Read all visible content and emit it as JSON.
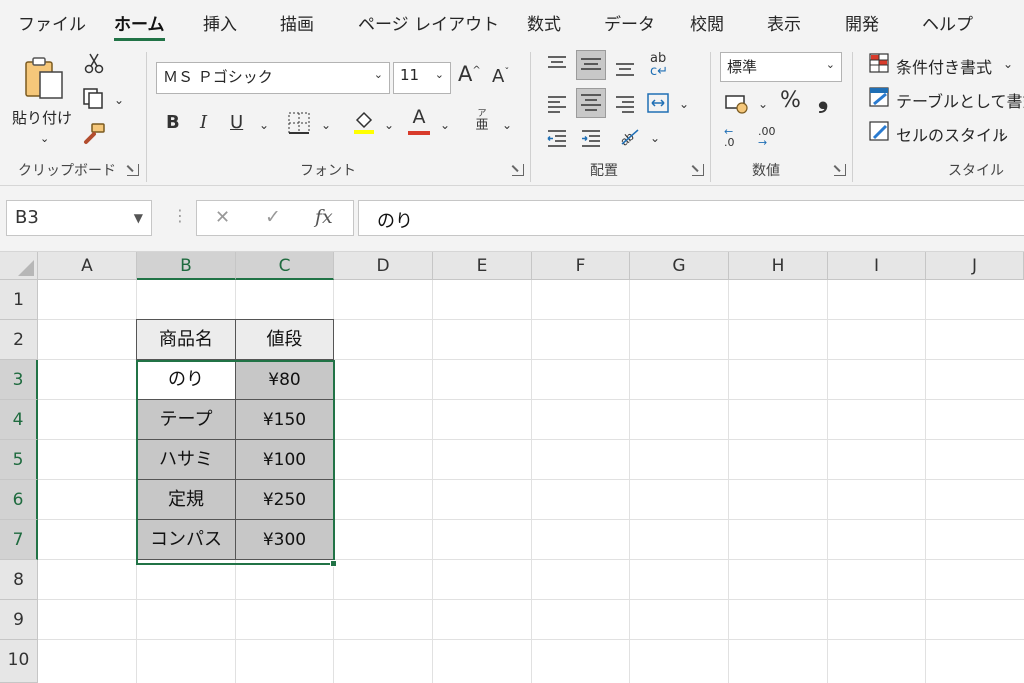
{
  "menu": {
    "tabs": [
      {
        "label": "ファイル"
      },
      {
        "label": "ホーム",
        "active": true
      },
      {
        "label": "挿入"
      },
      {
        "label": "描画"
      },
      {
        "label": "ページ レイアウト"
      },
      {
        "label": "数式"
      },
      {
        "label": "データ"
      },
      {
        "label": "校閲"
      },
      {
        "label": "表示"
      },
      {
        "label": "開発"
      },
      {
        "label": "ヘルプ"
      }
    ]
  },
  "ribbon": {
    "clipboard": {
      "paste_label": "貼り付け",
      "group_label": "クリップボード"
    },
    "font": {
      "font_name": "ＭＳ Ｐゴシック",
      "font_size": "11",
      "group_label": "フォント",
      "bold": "B",
      "italic": "I",
      "underline": "U",
      "phonetic_top": "ア",
      "phonetic_bottom": "亜",
      "grow_label": "A",
      "shrink_label": "A",
      "font_color_label": "A",
      "font_color": "#d83b2b"
    },
    "alignment": {
      "group_label": "配置",
      "wrap_label": "ab"
    },
    "number": {
      "format": "標準",
      "percent": "%",
      "comma": "❟",
      "inc_decimal": ".0",
      "dec_decimal": ".00",
      "group_label": "数値"
    },
    "styles": {
      "conditional": "条件付き書式",
      "as_table": "テーブルとして書式",
      "cell_styles": "セルのスタイル",
      "group_label": "スタイル"
    }
  },
  "formula_bar": {
    "name_box": "B3",
    "cancel": "✕",
    "enter": "✓",
    "fx": "fx",
    "content": "のり"
  },
  "sheet": {
    "columns": [
      "A",
      "B",
      "C",
      "D",
      "E",
      "F",
      "G",
      "H",
      "I",
      "J"
    ],
    "rows": [
      "1",
      "2",
      "3",
      "4",
      "5",
      "6",
      "7",
      "8",
      "9",
      "10"
    ],
    "selected_range": "B3:C7",
    "table": {
      "headers": [
        "商品名",
        "値段"
      ],
      "rows": [
        [
          "のり",
          "¥80"
        ],
        [
          "テープ",
          "¥150"
        ],
        [
          "ハサミ",
          "¥100"
        ],
        [
          "定規",
          "¥250"
        ],
        [
          "コンパス",
          "¥300"
        ]
      ]
    }
  },
  "colors": {
    "accent": "#217346",
    "ribbon_bg": "#f3f3f3",
    "table_fill": "#c7c7c7"
  }
}
